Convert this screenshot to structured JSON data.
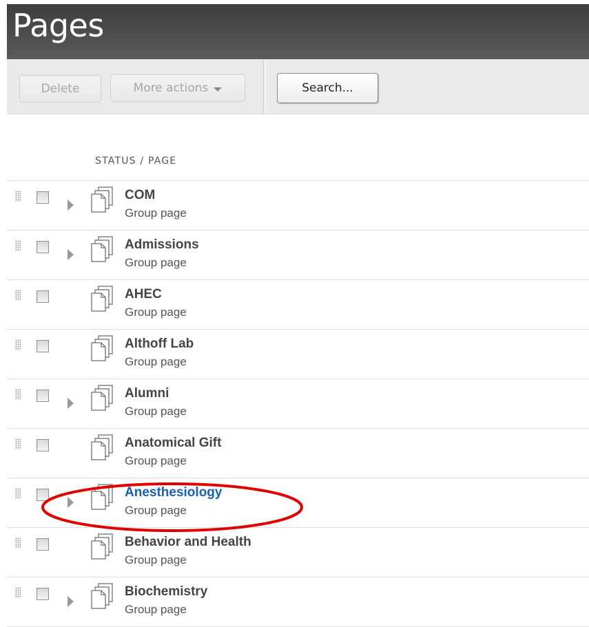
{
  "header": {
    "title": "Pages"
  },
  "toolbar": {
    "delete_label": "Delete",
    "more_actions_label": "More actions",
    "search_label": "Search..."
  },
  "list": {
    "column_header": "STATUS / PAGE",
    "rows": [
      {
        "title": "COM",
        "subtitle": "Group page",
        "has_children": true,
        "highlighted": false
      },
      {
        "title": "Admissions",
        "subtitle": "Group page",
        "has_children": true,
        "highlighted": false
      },
      {
        "title": "AHEC",
        "subtitle": "Group page",
        "has_children": false,
        "highlighted": false
      },
      {
        "title": "Althoff Lab",
        "subtitle": "Group page",
        "has_children": false,
        "highlighted": false
      },
      {
        "title": "Alumni",
        "subtitle": "Group page",
        "has_children": true,
        "highlighted": false
      },
      {
        "title": "Anatomical Gift",
        "subtitle": "Group page",
        "has_children": false,
        "highlighted": false
      },
      {
        "title": "Anesthesiology",
        "subtitle": "Group page",
        "has_children": true,
        "highlighted": true
      },
      {
        "title": "Behavior and Health",
        "subtitle": "Group page",
        "has_children": false,
        "highlighted": false
      },
      {
        "title": "Biochemistry",
        "subtitle": "Group page",
        "has_children": true,
        "highlighted": false
      }
    ]
  },
  "icons": {
    "drag_handle": "drag-handle-icon",
    "expand": "triangle-right-icon",
    "page": "page-stack-icon",
    "dropdown": "caret-down-icon"
  },
  "colors": {
    "header_bg": "#4a4a4a",
    "toolbar_bg": "#eaeaea",
    "link_blue": "#1a5fb4",
    "annotation_red": "#e00000"
  }
}
